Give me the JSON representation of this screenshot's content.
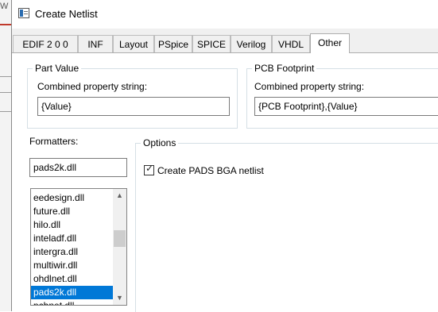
{
  "window": {
    "title": "Create Netlist"
  },
  "tabs": [
    {
      "label": "EDIF 2 0 0",
      "active": false
    },
    {
      "label": "INF",
      "active": false
    },
    {
      "label": "Layout",
      "active": false
    },
    {
      "label": "PSpice",
      "active": false
    },
    {
      "label": "SPICE",
      "active": false
    },
    {
      "label": "Verilog",
      "active": false
    },
    {
      "label": "VHDL",
      "active": false
    },
    {
      "label": "Other",
      "active": true
    }
  ],
  "part_value": {
    "legend": "Part Value",
    "field_label": "Combined property string:",
    "value": "{Value}"
  },
  "pcb_footprint": {
    "legend": "PCB Footprint",
    "field_label": "Combined property string:",
    "value": "{PCB Footprint},{Value}"
  },
  "formatters": {
    "label": "Formatters:",
    "current": "pads2k.dll",
    "items": [
      "eedesign.dll",
      "future.dll",
      "hilo.dll",
      "inteladf.dll",
      "intergra.dll",
      "multiwir.dll",
      "ohdlnet.dll",
      "pads2k.dll",
      "pcbnet.dll"
    ],
    "selected_index": 7
  },
  "options": {
    "legend": "Options",
    "checkbox_label": "Create PADS BGA netlist",
    "checked": true
  },
  "background": {
    "fragment": "W"
  }
}
